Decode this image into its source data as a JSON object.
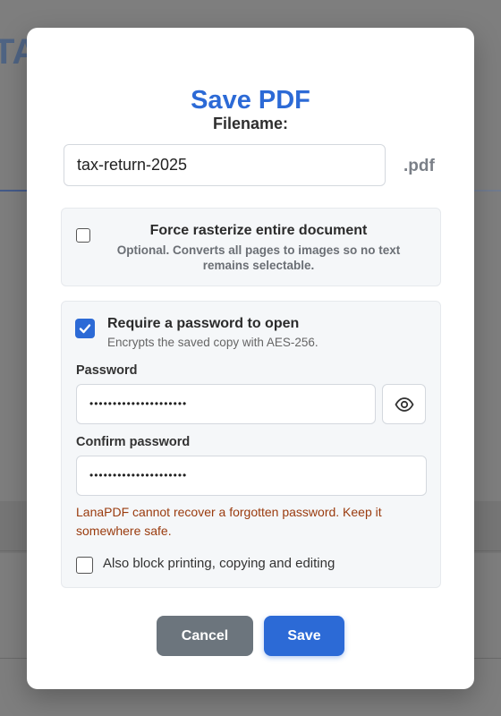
{
  "dialog": {
    "title": "Save PDF",
    "filename_label": "Filename:",
    "filename_value": "tax-return-2025",
    "extension": ".pdf"
  },
  "rasterize": {
    "checked": false,
    "title": "Force rasterize entire document",
    "description": "Optional. Converts all pages to images so no text remains selectable."
  },
  "password": {
    "checked": true,
    "title": "Require a password to open",
    "description": "Encrypts the saved copy with AES-256.",
    "password_label": "Password",
    "password_value": "•••••••••••••••••••••",
    "confirm_label": "Confirm password",
    "confirm_value": "•••••••••••••••••••••",
    "toggle_icon": "eye-icon",
    "warning": "LanaPDF cannot recover a forgotten password. Keep it somewhere safe.",
    "block_label": "Also block printing, copying and editing",
    "block_checked": false
  },
  "buttons": {
    "cancel": "Cancel",
    "save": "Save"
  },
  "colors": {
    "accent": "#2c6ad6",
    "warning": "#9a3b0e",
    "cancel": "#6c757d"
  }
}
